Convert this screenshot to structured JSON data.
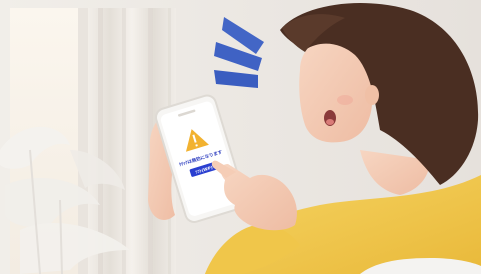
{
  "phone": {
    "warning_text": "ｸﾘｯｸは無効になります",
    "button_label": "ｿﾌﾄ(WP)"
  },
  "colors": {
    "wall": "#ece8e4",
    "curtain": "#f1ede8",
    "sweater": "#f2c94c",
    "hair": "#4a2e22",
    "skin": "#f4cdb8",
    "alert": "#3f63c8",
    "warning": "#f2b230",
    "phone_button": "#2a3fd0"
  },
  "icons": [
    "warning-icon",
    "alert-sound-waves-icon"
  ]
}
